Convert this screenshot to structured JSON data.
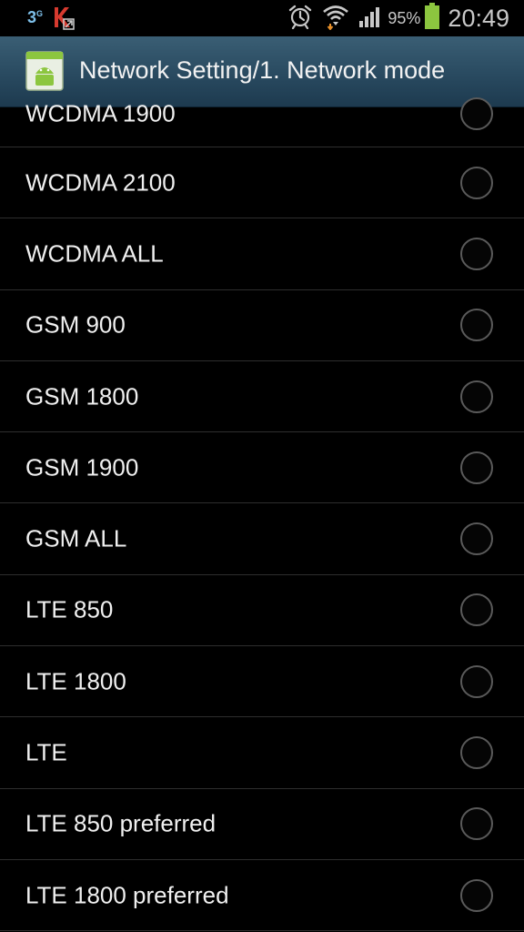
{
  "status_bar": {
    "carrier_icon_text": "3",
    "carrier_icon_sup": "G",
    "battery_percent": "95%",
    "time": "20:49",
    "icons": [
      "carrier-3-icon",
      "kaspersky-icon",
      "alarm-icon",
      "wifi-icon",
      "signal-icon",
      "battery-icon"
    ],
    "battery_color": "#8cc63f"
  },
  "header": {
    "title": "Network Setting/1. Network mode",
    "icon": "android-app-icon",
    "background": "#294a60"
  },
  "options": [
    {
      "label": "WCDMA 1900",
      "selected": false
    },
    {
      "label": "WCDMA 2100",
      "selected": false
    },
    {
      "label": "WCDMA ALL",
      "selected": false
    },
    {
      "label": "GSM 900",
      "selected": false
    },
    {
      "label": "GSM 1800",
      "selected": false
    },
    {
      "label": "GSM 1900",
      "selected": false
    },
    {
      "label": "GSM ALL",
      "selected": false
    },
    {
      "label": "LTE 850",
      "selected": false
    },
    {
      "label": "LTE 1800",
      "selected": false
    },
    {
      "label": "LTE",
      "selected": false
    },
    {
      "label": "LTE 850 preferred",
      "selected": false
    },
    {
      "label": "LTE 1800 preferred",
      "selected": false
    }
  ]
}
